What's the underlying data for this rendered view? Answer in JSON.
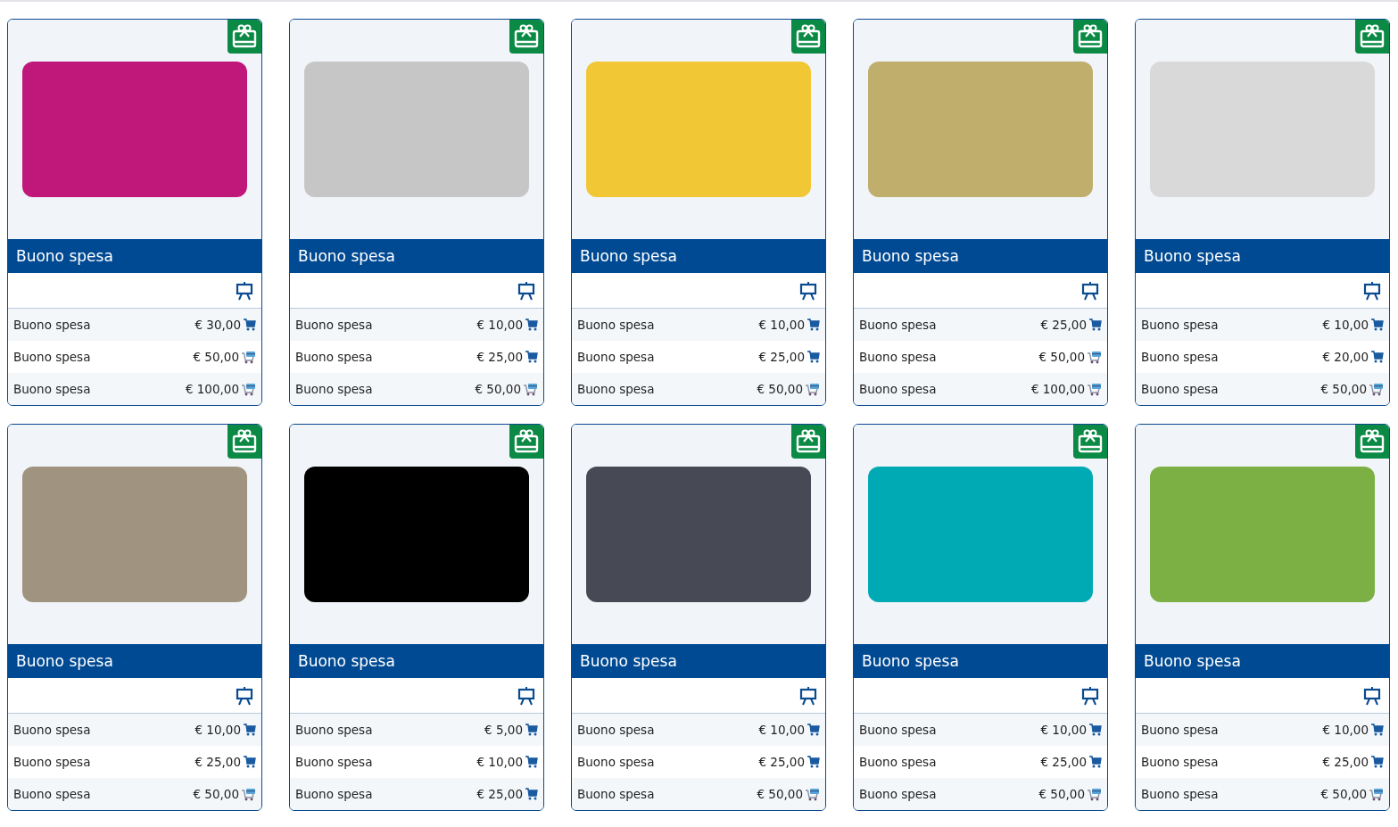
{
  "products": [
    {
      "color": "#c0177a",
      "title": "Buono spesa",
      "options": [
        {
          "label": "Buono spesa",
          "price": "€ 30,00",
          "kind": "cart"
        },
        {
          "label": "Buono spesa",
          "price": "€ 50,00",
          "kind": "card-cart"
        },
        {
          "label": "Buono spesa",
          "price": "€ 100,00",
          "kind": "card-cart"
        }
      ]
    },
    {
      "color": "#c6c6c6",
      "title": "Buono spesa",
      "options": [
        {
          "label": "Buono spesa",
          "price": "€ 10,00",
          "kind": "cart"
        },
        {
          "label": "Buono spesa",
          "price": "€ 25,00",
          "kind": "cart"
        },
        {
          "label": "Buono spesa",
          "price": "€ 50,00",
          "kind": "card-cart"
        }
      ]
    },
    {
      "color": "#f2c736",
      "title": "Buono spesa",
      "options": [
        {
          "label": "Buono spesa",
          "price": "€ 10,00",
          "kind": "cart"
        },
        {
          "label": "Buono spesa",
          "price": "€ 25,00",
          "kind": "cart"
        },
        {
          "label": "Buono spesa",
          "price": "€ 50,00",
          "kind": "card-cart"
        }
      ]
    },
    {
      "color": "#bfae6c",
      "title": "Buono spesa",
      "options": [
        {
          "label": "Buono spesa",
          "price": "€ 25,00",
          "kind": "cart"
        },
        {
          "label": "Buono spesa",
          "price": "€ 50,00",
          "kind": "card-cart"
        },
        {
          "label": "Buono spesa",
          "price": "€ 100,00",
          "kind": "card-cart"
        }
      ]
    },
    {
      "color": "#d9d9d9",
      "title": "Buono spesa",
      "options": [
        {
          "label": "Buono spesa",
          "price": "€ 10,00",
          "kind": "cart"
        },
        {
          "label": "Buono spesa",
          "price": "€ 20,00",
          "kind": "cart"
        },
        {
          "label": "Buono spesa",
          "price": "€ 50,00",
          "kind": "card-cart"
        }
      ]
    },
    {
      "color": "#a0937f",
      "title": "Buono spesa",
      "options": [
        {
          "label": "Buono spesa",
          "price": "€ 10,00",
          "kind": "cart"
        },
        {
          "label": "Buono spesa",
          "price": "€ 25,00",
          "kind": "cart"
        },
        {
          "label": "Buono spesa",
          "price": "€ 50,00",
          "kind": "card-cart"
        }
      ]
    },
    {
      "color": "#000000",
      "title": "Buono spesa",
      "options": [
        {
          "label": "Buono spesa",
          "price": "€ 5,00",
          "kind": "cart"
        },
        {
          "label": "Buono spesa",
          "price": "€ 10,00",
          "kind": "cart"
        },
        {
          "label": "Buono spesa",
          "price": "€ 25,00",
          "kind": "cart"
        }
      ]
    },
    {
      "color": "#474a55",
      "title": "Buono spesa",
      "options": [
        {
          "label": "Buono spesa",
          "price": "€ 10,00",
          "kind": "cart"
        },
        {
          "label": "Buono spesa",
          "price": "€ 25,00",
          "kind": "cart"
        },
        {
          "label": "Buono spesa",
          "price": "€ 50,00",
          "kind": "card-cart"
        }
      ]
    },
    {
      "color": "#00aab5",
      "title": "Buono spesa",
      "options": [
        {
          "label": "Buono spesa",
          "price": "€ 10,00",
          "kind": "cart"
        },
        {
          "label": "Buono spesa",
          "price": "€ 25,00",
          "kind": "cart"
        },
        {
          "label": "Buono spesa",
          "price": "€ 50,00",
          "kind": "card-cart"
        }
      ]
    },
    {
      "color": "#7db044",
      "title": "Buono spesa",
      "options": [
        {
          "label": "Buono spesa",
          "price": "€ 10,00",
          "kind": "cart"
        },
        {
          "label": "Buono spesa",
          "price": "€ 25,00",
          "kind": "cart"
        },
        {
          "label": "Buono spesa",
          "price": "€ 50,00",
          "kind": "card-cart"
        }
      ]
    }
  ]
}
